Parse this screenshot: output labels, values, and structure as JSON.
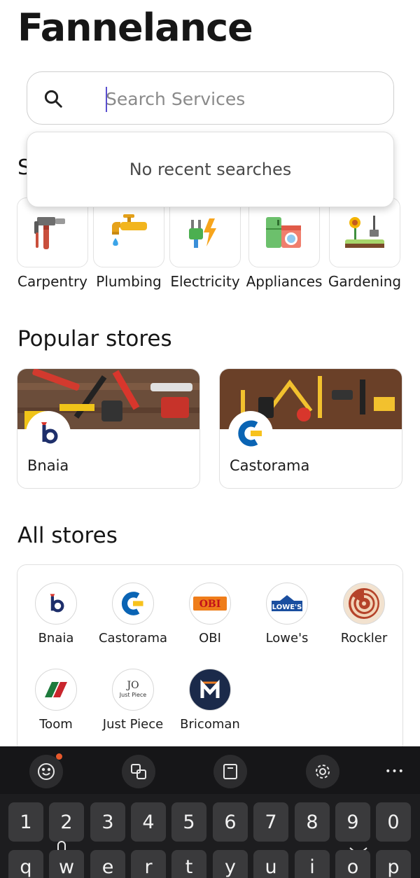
{
  "app": {
    "title": "Fannelance"
  },
  "search": {
    "placeholder": "Search Services",
    "value": ""
  },
  "recent": {
    "empty_text": "No recent searches"
  },
  "services_heading_partial": "S",
  "categories": [
    {
      "label": "Carpentry",
      "icon": "hammer-icon"
    },
    {
      "label": "Plumbing",
      "icon": "faucet-icon"
    },
    {
      "label": "Electricity",
      "icon": "plug-icon"
    },
    {
      "label": "Appliances",
      "icon": "appliances-icon"
    },
    {
      "label": "Gardening",
      "icon": "gardening-icon"
    }
  ],
  "popular": {
    "title": "Popular stores",
    "stores": [
      {
        "name": "Bnaia",
        "logo": "bnaia-logo"
      },
      {
        "name": "Castorama",
        "logo": "castorama-logo"
      }
    ]
  },
  "all": {
    "title": "All stores",
    "stores": [
      {
        "name": "Bnaia",
        "logo_text": "b"
      },
      {
        "name": "Castorama",
        "logo_text": "C"
      },
      {
        "name": "OBI",
        "logo_text": "OBI"
      },
      {
        "name": "Lowe's",
        "logo_text": "LOWE'S"
      },
      {
        "name": "Rockler",
        "logo_text": ""
      },
      {
        "name": "Toom",
        "logo_text": ""
      },
      {
        "name": "Just Piece",
        "logo_text": "Just Piece"
      },
      {
        "name": "Bricoman",
        "logo_text": "M"
      }
    ]
  },
  "keyboard": {
    "tools": [
      "emoji-icon",
      "translate-icon",
      "clipboard-icon",
      "settings-icon",
      "more-icon"
    ],
    "more_glyph": "•••",
    "number_row": [
      "1",
      "2",
      "3",
      "4",
      "5",
      "6",
      "7",
      "8",
      "9",
      "0"
    ],
    "letter_row": [
      "q",
      "w",
      "e",
      "r",
      "t",
      "y",
      "u",
      "i",
      "o",
      "p"
    ]
  },
  "colors": {
    "accent": "#5a4fcf",
    "keyboard_bg": "#1d1d1f",
    "notification_dot": "#e8592c"
  }
}
